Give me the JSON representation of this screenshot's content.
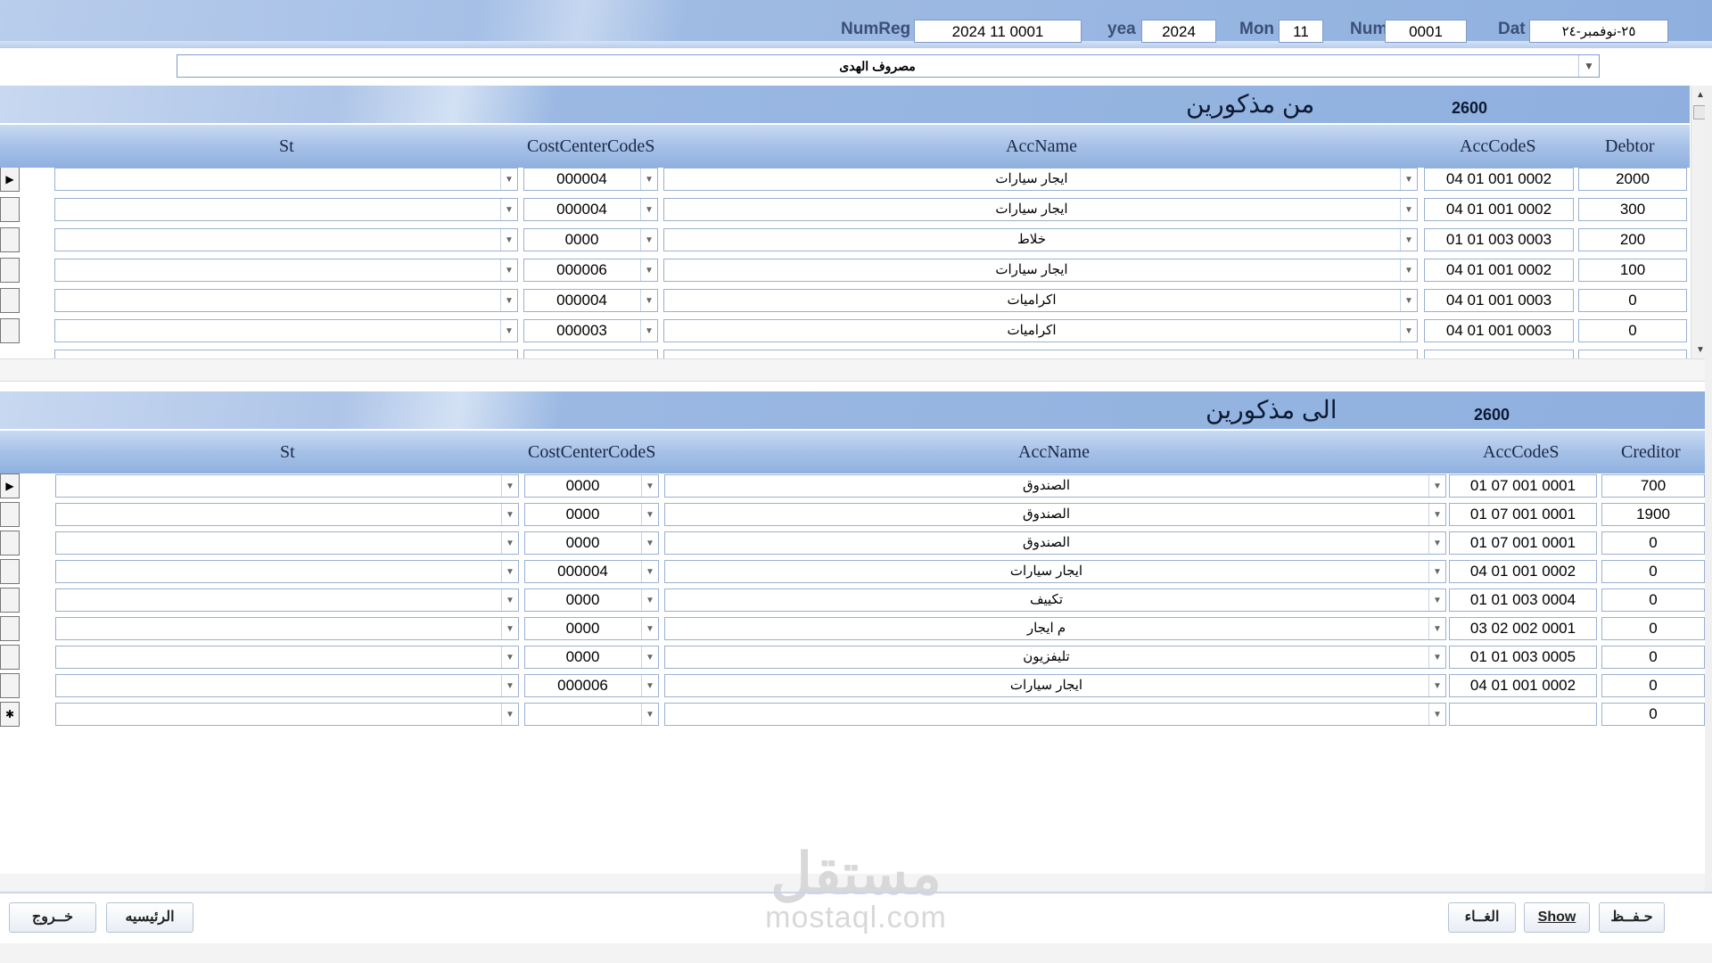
{
  "header": {
    "numreg_label": "NumReg",
    "numreg_value": "2024 11 0001",
    "year_label": "yea",
    "year_value": "2024",
    "month_label": "Mon",
    "month_value": "11",
    "num_label": "Num",
    "num_value": "0001",
    "date_label": "Dat",
    "date_value": "٢٥-نوفمبر-٢٤"
  },
  "description_combo": {
    "value": "مصروف الهدى"
  },
  "debit": {
    "title": "من مذكورين",
    "total": "2600",
    "columns": {
      "st": "St",
      "cost_center": "CostCenterCodeS",
      "acc_name": "AccName",
      "acc_code": "AccCodeS",
      "amount": "Debtor"
    },
    "rows": [
      {
        "amount": "2000",
        "acc_code": "04 01 001 0002",
        "acc_name": "ايجار سيارات",
        "cost_center": "000004",
        "st": ""
      },
      {
        "amount": "300",
        "acc_code": "04 01 001 0002",
        "acc_name": "ايجار سيارات",
        "cost_center": "000004",
        "st": ""
      },
      {
        "amount": "200",
        "acc_code": "01 01 003 0003",
        "acc_name": "خلاط",
        "cost_center": "0000",
        "st": ""
      },
      {
        "amount": "100",
        "acc_code": "04 01 001 0002",
        "acc_name": "ايجار سيارات",
        "cost_center": "000006",
        "st": ""
      },
      {
        "amount": "0",
        "acc_code": "04 01 001 0003",
        "acc_name": "اكراميات",
        "cost_center": "000004",
        "st": ""
      },
      {
        "amount": "0",
        "acc_code": "04 01 001 0003",
        "acc_name": "اكراميات",
        "cost_center": "000003",
        "st": ""
      }
    ]
  },
  "credit": {
    "title": "الى مذكورين",
    "total": "2600",
    "columns": {
      "st": "St",
      "cost_center": "CostCenterCodeS",
      "acc_name": "AccName",
      "acc_code": "AccCodeS",
      "amount": "Creditor"
    },
    "rows": [
      {
        "amount": "700",
        "acc_code": "01 07 001 0001",
        "acc_name": "الصندوق",
        "cost_center": "0000",
        "st": ""
      },
      {
        "amount": "1900",
        "acc_code": "01 07 001 0001",
        "acc_name": "الصندوق",
        "cost_center": "0000",
        "st": ""
      },
      {
        "amount": "0",
        "acc_code": "01 07 001 0001",
        "acc_name": "الصندوق",
        "cost_center": "0000",
        "st": ""
      },
      {
        "amount": "0",
        "acc_code": "04 01 001 0002",
        "acc_name": "ايجار سيارات",
        "cost_center": "000004",
        "st": ""
      },
      {
        "amount": "0",
        "acc_code": "01 01 003 0004",
        "acc_name": "تكييف",
        "cost_center": "0000",
        "st": ""
      },
      {
        "amount": "0",
        "acc_code": "03 02 002 0001",
        "acc_name": "م ايجار",
        "cost_center": "0000",
        "st": ""
      },
      {
        "amount": "0",
        "acc_code": "01 01 003 0005",
        "acc_name": "تليفزيون",
        "cost_center": "0000",
        "st": ""
      },
      {
        "amount": "0",
        "acc_code": "04 01 001 0002",
        "acc_name": "ايجار سيارات",
        "cost_center": "000006",
        "st": ""
      },
      {
        "amount": "0",
        "acc_code": "",
        "acc_name": "",
        "cost_center": "",
        "st": ""
      }
    ]
  },
  "buttons": {
    "save": "حـفــظ",
    "show": "Show",
    "cancel": "الغــاء",
    "home": "الرئيسيه",
    "exit": "خــروج"
  },
  "watermark": {
    "arabic": "مستقل",
    "latin": "mostaql.com"
  },
  "colors": {
    "header_blue": "#8fb0df",
    "label_text": "#3b4f78",
    "border": "#9ab0d0"
  }
}
